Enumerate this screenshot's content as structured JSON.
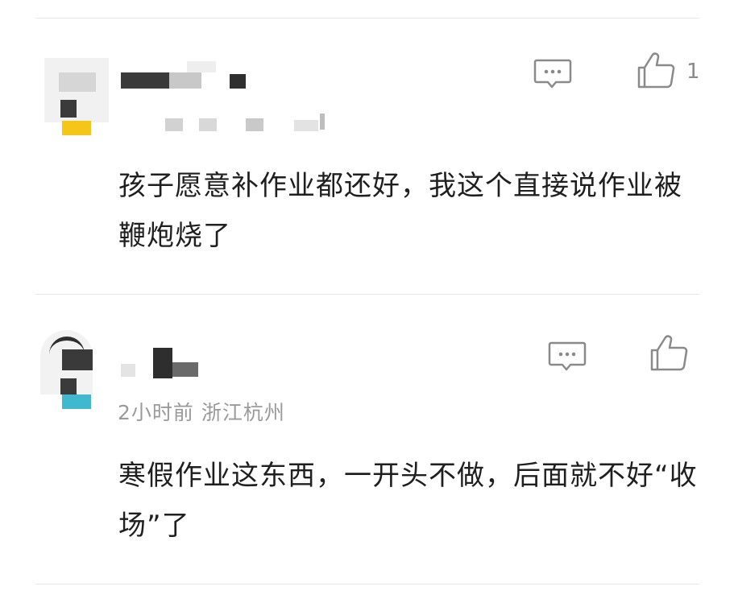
{
  "comments": [
    {
      "meta": "",
      "text": "孩子愿意补作业都还好，我这个直接说作业被鞭炮烧了",
      "like_count": "1"
    },
    {
      "meta": "2小时前  浙江杭州",
      "text": "寒假作业这东西，一开头不做，后面就不好“收场”了",
      "like_count": ""
    }
  ],
  "icons": {
    "reply": "comment-bubble-icon",
    "like": "thumbs-up-icon"
  },
  "colors": {
    "divider": "#e6e6e6",
    "meta_text": "#9a9a9a",
    "icon_stroke": "#8a8a8a",
    "avatar_badge_1": "#f5c518",
    "avatar_badge_2": "#3fb8d0"
  }
}
